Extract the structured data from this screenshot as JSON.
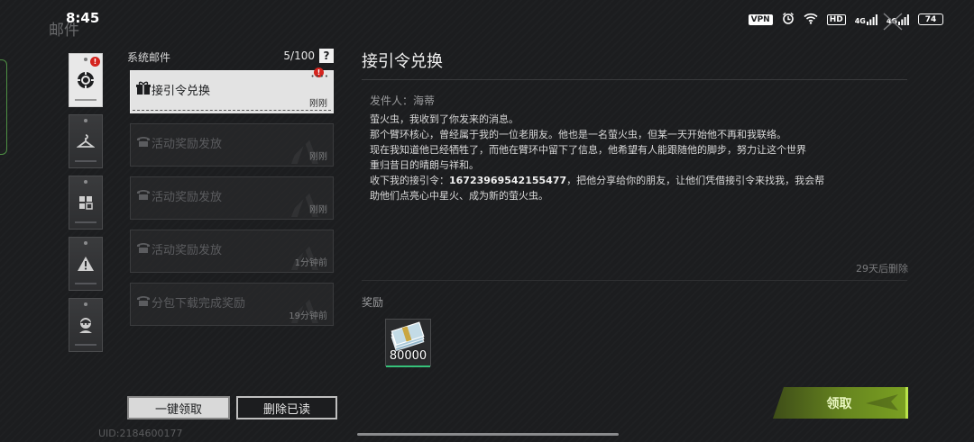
{
  "status_bar": {
    "time": "8:45",
    "vpn": "VPN",
    "hd": "HD",
    "net1": "4G",
    "net2": "4G",
    "battery": "74"
  },
  "page_title": "邮件",
  "tabs": [
    {
      "name": "system",
      "badge": "!"
    },
    {
      "name": "tab-2",
      "badge": ""
    },
    {
      "name": "tab-3",
      "badge": ""
    },
    {
      "name": "tab-4",
      "badge": ""
    },
    {
      "name": "tab-5",
      "badge": ""
    }
  ],
  "mail_list": {
    "title": "系统邮件",
    "count": "5/100",
    "help": "?",
    "items": [
      {
        "title": "接引令兑换",
        "time": "刚刚",
        "selected": true,
        "badge": "!"
      },
      {
        "title": "活动奖励发放",
        "time": "刚刚"
      },
      {
        "title": "活动奖励发放",
        "time": "刚刚"
      },
      {
        "title": "活动奖励发放",
        "time": "1分钟前"
      },
      {
        "title": "分包下载完成奖励",
        "time": "19分钟前"
      }
    ]
  },
  "buttons": {
    "collect_all": "一键领取",
    "delete_read": "删除已读",
    "claim": "领取"
  },
  "uid": "UID:2184600177",
  "detail": {
    "title": "接引令兑换",
    "sender": "发件人：海蒂",
    "lines": [
      "萤火虫，我收到了你发来的消息。",
      "那个臂环核心，曾经属于我的一位老朋友。他也是一名萤火虫，但某一天开始他不再和我联络。",
      "现在我知道他已经牺牲了，而他在臂环中留下了信息，他希望有人能跟随他的脚步，努力让这个世界",
      "重归昔日的晴朗与祥和。",
      "收下我的接引令：",
      "16723969542155477",
      "，把他分享给你的朋友，让他们凭借接引令来找我，我会帮",
      "助他们点亮心中星火、成为新的萤火虫。"
    ],
    "expire": "29天后删除",
    "reward_label": "奖励",
    "reward": {
      "icon": "money-bundle-icon",
      "amount": "80000"
    }
  },
  "colors": {
    "background": "#1c1d1f",
    "accent_green": "#7aa022",
    "badge_red": "#d4231d"
  }
}
